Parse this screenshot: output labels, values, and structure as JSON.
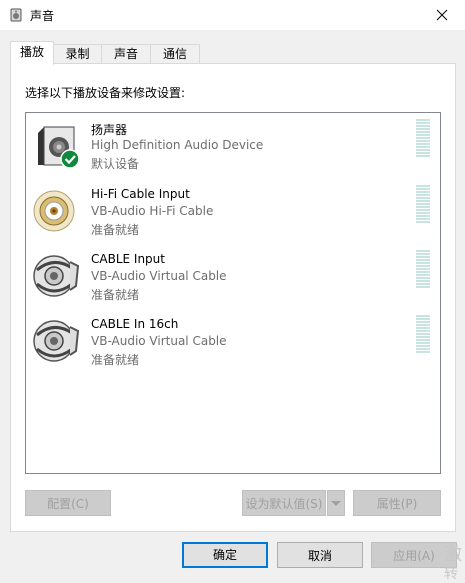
{
  "window": {
    "title": "声音"
  },
  "tabs": [
    {
      "label": "播放",
      "active": true
    },
    {
      "label": "录制"
    },
    {
      "label": "声音"
    },
    {
      "label": "通信"
    }
  ],
  "instruction": "选择以下播放设备来修改设置:",
  "devices": [
    {
      "name": "扬声器",
      "description": "High Definition Audio Device",
      "status": "默认设备",
      "icon": "speaker-default-icon"
    },
    {
      "name": "Hi-Fi Cable Input",
      "description": "VB-Audio Hi-Fi Cable",
      "status": "准备就绪",
      "icon": "rca-plug-icon"
    },
    {
      "name": "CABLE Input",
      "description": "VB-Audio Virtual Cable",
      "status": "准备就绪",
      "icon": "virtual-cable-icon"
    },
    {
      "name": "CABLE In 16ch",
      "description": "VB-Audio Virtual Cable",
      "status": "准备就绪",
      "icon": "virtual-cable-icon"
    }
  ],
  "buttons": {
    "configure": "配置(C)",
    "set_default": "设为默认值(S)",
    "properties": "属性(P)",
    "ok": "确定",
    "cancel": "取消",
    "apply": "应用(A)"
  },
  "watermark": {
    "line1": "激",
    "line2": "转"
  },
  "colors": {
    "accent": "#0078d7",
    "meter": "#c7e4e1",
    "check": "#10893e"
  }
}
